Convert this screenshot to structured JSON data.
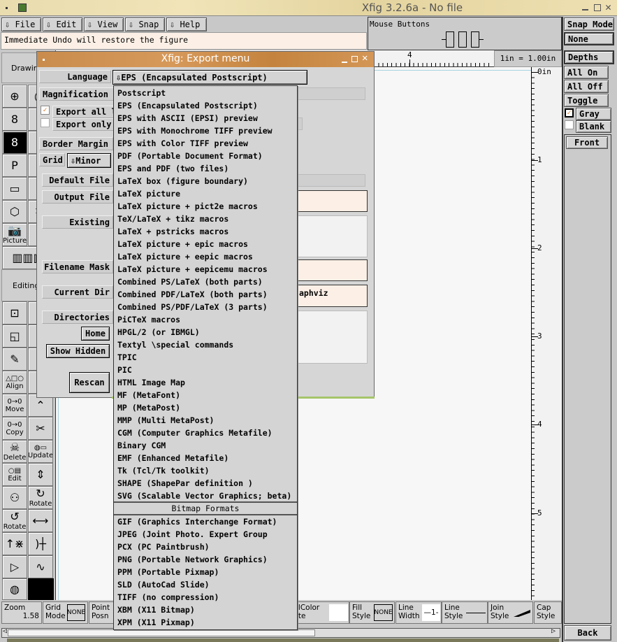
{
  "window": {
    "title": "Xfig 3.2.6a - No file"
  },
  "menubar": [
    "File",
    "Edit",
    "View",
    "Snap",
    "Help"
  ],
  "message": "Immediate Undo will restore the figure",
  "mouse_panel": {
    "label": "Mouse Buttons"
  },
  "right_panel": {
    "snap_mode": "Snap Mode",
    "snap_value": "None",
    "depths": "Depths",
    "all_on": "All On",
    "all_off": "All Off",
    "toggle": "Toggle",
    "gray": "Gray",
    "gray_checked": true,
    "blank": "Blank",
    "blank_checked": false,
    "front": "Front",
    "back": "Back"
  },
  "ruler": {
    "top_label": "4",
    "scale": "1in = 1.00in",
    "side_labels": [
      "0in",
      "1",
      "2",
      "3",
      "4",
      "5"
    ]
  },
  "tools": {
    "drawing": "Drawing",
    "editing": "Editing",
    "picture": "Picture",
    "align": "Align",
    "move": "Move",
    "copy": "Copy",
    "delete": "Delete",
    "update": "Update",
    "edit": "Edit",
    "rotate_cw": "Rotate",
    "rotate_ccw": "Rotate"
  },
  "export": {
    "title": "Xfig: Export menu",
    "language_label": "Language",
    "language_value": "EPS (Encapsulated Postscript)",
    "magnification": "Magnification %",
    "export_all": "Export all l",
    "export_all_checked": true,
    "export_only": "Export only",
    "export_only_checked": false,
    "border_margin": "Border Margin",
    "grid": "Grid",
    "grid_value": "Minor",
    "default_file": "Default File",
    "output_file": "Output File",
    "existing": "Existing",
    "filename_mask": "Filename Mask",
    "current_dir": "Current Dir",
    "current_dir_value": "aphviz",
    "directories": "Directories",
    "home": "Home",
    "show_hidden": "Show Hidden",
    "rescan": "Rescan"
  },
  "language_menu": {
    "items": [
      "Postscript",
      "EPS (Encapsulated Postscript)",
      "EPS with ASCII (EPSI) preview",
      "EPS with Monochrome TIFF preview",
      "EPS with Color TIFF preview",
      "PDF (Portable Document Format)",
      "EPS and PDF (two files)",
      "LaTeX box (figure boundary)",
      "LaTeX picture",
      "LaTeX picture + pict2e macros",
      "TeX/LaTeX + tikz macros",
      "LaTeX + pstricks macros",
      "LaTeX picture + epic macros",
      "LaTeX picture + eepic macros",
      "LaTeX picture + eepicemu macros",
      "Combined PS/LaTeX (both parts)",
      "Combined PDF/LaTeX (both parts)",
      "Combined PS/PDF/LaTeX (3 parts)",
      "PiCTeX macros",
      "HPGL/2 (or IBMGL)",
      "Textyl \\special commands",
      "TPIC",
      "PIC",
      "HTML Image Map",
      "MF  (MetaFont)",
      "MP  (MetaPost)",
      "MMP (Multi MetaPost)",
      "CGM (Computer Graphics Metafile)",
      "Binary CGM",
      "EMF (Enhanced Metafile)",
      "Tk  (Tcl/Tk toolkit)",
      "SHAPE (ShapePar definition )",
      "SVG (Scalable Vector Graphics; beta)"
    ],
    "bitmap_header": "Bitmap Formats",
    "bitmap_items": [
      "GIF  (Graphics Interchange Format)",
      "JPEG (Joint Photo. Expert Group",
      "PCX  (PC Paintbrush)",
      "PNG  (Portable Network Graphics)",
      "PPM  (Portable Pixmap)",
      "SLD  (AutoCad Slide)",
      "TIFF (no compression)",
      "XBM  (X11 Bitmap)",
      "XPM  (X11 Pixmap)"
    ]
  },
  "bottom": {
    "zoom": "Zoom",
    "zoom_value": "1.58",
    "grid_mode": [
      "Grid",
      "Mode"
    ],
    "grid_value": "NONE",
    "point_posn": [
      "Point",
      "Posn"
    ],
    "fill_color": [
      "llColor",
      "ite"
    ],
    "fill_style": [
      "Fill",
      "Style"
    ],
    "fill_value": "NONE",
    "line_width": [
      "Line",
      "Width"
    ],
    "line_width_value": "1",
    "line_style": [
      "Line",
      "Style"
    ],
    "join_style": [
      "Join",
      "Style"
    ],
    "cap_style": [
      "Cap",
      "Style"
    ]
  }
}
